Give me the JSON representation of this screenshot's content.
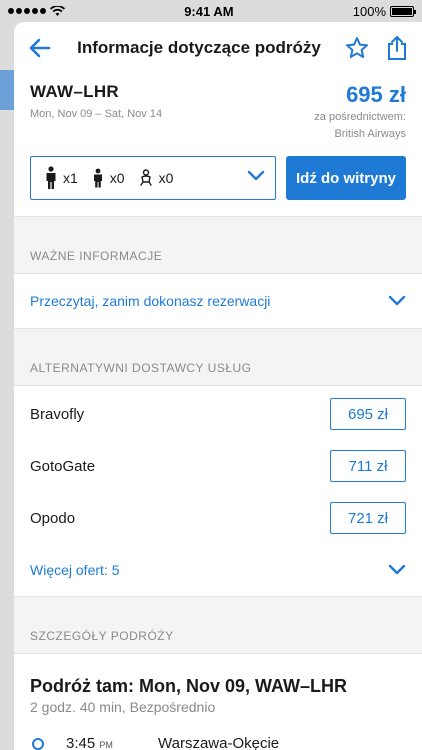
{
  "status": {
    "time": "9:41 AM",
    "battery": "100%"
  },
  "header": {
    "title": "Informacje dotyczące podróży"
  },
  "trip": {
    "route": "WAW–LHR",
    "dates": "Mon, Nov 09 – Sat, Nov 14",
    "price": "695 zł",
    "via_label": "za pośrednictwem:",
    "via_airline": "British Airways"
  },
  "passengers": {
    "adults": "x1",
    "children": "x0",
    "infants": "x0"
  },
  "go_button": "Idź do witryny",
  "important": {
    "section": "WAŻNE INFORMACJE",
    "link": "Przeczytaj, zanim dokonasz rezerwacji"
  },
  "providers": {
    "section": "ALTERNATYWNI DOSTAWCY USŁUG",
    "items": [
      {
        "name": "Bravofly",
        "price": "695 zł"
      },
      {
        "name": "GotoGate",
        "price": "711 zł"
      },
      {
        "name": "Opodo",
        "price": "721 zł"
      }
    ],
    "more": "Więcej ofert: 5"
  },
  "details": {
    "section": "SZCZEGÓŁY PODRÓŻY",
    "title": "Podróż tam: Mon, Nov 09, WAW–LHR",
    "subtitle": "2 godz. 40 min, Bezpośrednio",
    "segment_time": "3:45",
    "segment_ampm": "PM",
    "segment_place": "Warszawa-Okęcie"
  },
  "colors": {
    "accent": "#1f7ad6"
  }
}
